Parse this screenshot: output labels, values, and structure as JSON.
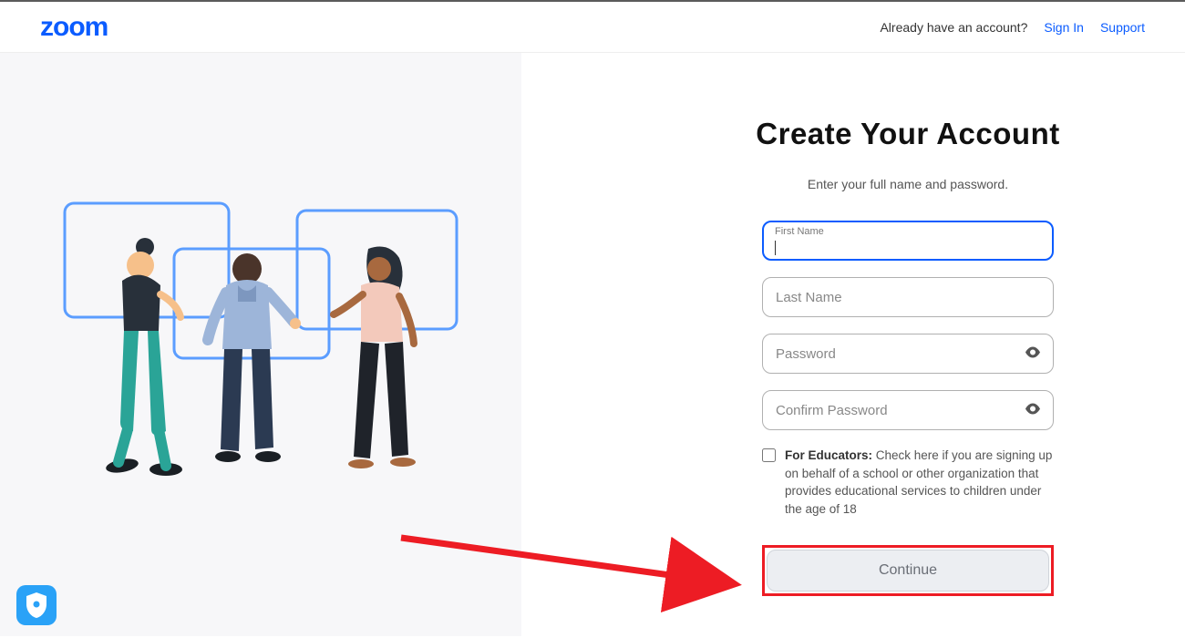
{
  "header": {
    "logo_text": "zoom",
    "already_text": "Already have an account?",
    "sign_in": "Sign In",
    "support": "Support"
  },
  "page": {
    "title": "Create Your Account",
    "subtitle": "Enter your full name and password."
  },
  "form": {
    "first_name_label": "First Name",
    "last_name_placeholder": "Last Name",
    "password_placeholder": "Password",
    "confirm_password_placeholder": "Confirm Password",
    "educators_bold": "For Educators:",
    "educators_text": " Check here if you are signing up on behalf of a school or other organization that provides educational services to children under the age of 18",
    "continue_label": "Continue"
  }
}
